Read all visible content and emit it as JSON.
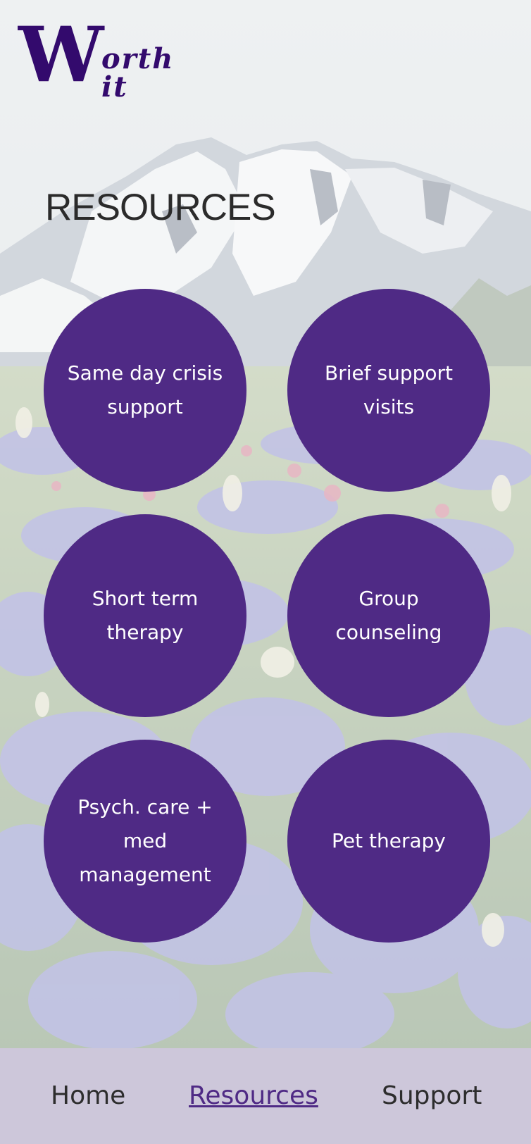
{
  "app": {
    "brand_initial": "W",
    "brand_word": "orth it"
  },
  "page": {
    "title": "RESOURCES"
  },
  "resources": [
    {
      "label": "Same day crisis support"
    },
    {
      "label": "Brief support visits"
    },
    {
      "label": "Short term therapy"
    },
    {
      "label": "Group counseling"
    },
    {
      "label": "Psych. care + med management"
    },
    {
      "label": "Pet therapy"
    }
  ],
  "nav": {
    "items": [
      {
        "label": "Home",
        "active": false
      },
      {
        "label": "Resources",
        "active": true
      },
      {
        "label": "Support",
        "active": false
      }
    ]
  },
  "colors": {
    "brand_purple": "#330a6d",
    "circle_purple": "#4f2a85",
    "nav_background": "#cdc7da",
    "active_link": "#4f2a85"
  }
}
